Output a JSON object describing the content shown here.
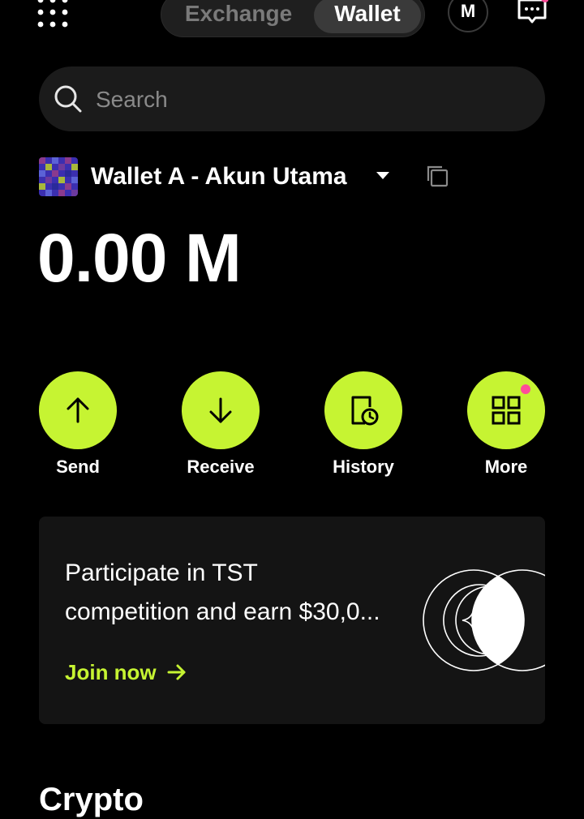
{
  "header": {
    "tabs": [
      {
        "label": "Exchange",
        "active": false
      },
      {
        "label": "Wallet",
        "active": true
      }
    ],
    "account_initial": "M",
    "icons": {
      "menu": "grid-dots-icon",
      "chat": "chat-icon"
    },
    "chat_has_notification": true
  },
  "search": {
    "placeholder": "Search",
    "value": ""
  },
  "wallet": {
    "name": "Wallet A - Akun Utama",
    "balance": "0.00 M"
  },
  "actions": [
    {
      "label": "Send",
      "icon": "arrow-up-icon"
    },
    {
      "label": "Receive",
      "icon": "arrow-down-icon"
    },
    {
      "label": "History",
      "icon": "history-icon"
    },
    {
      "label": "More",
      "icon": "apps-grid-icon",
      "has_notification": true
    }
  ],
  "promo": {
    "line1": "Participate in TST",
    "line2": "competition and earn $30,0...",
    "cta": "Join now"
  },
  "section_peek": "Crypto",
  "colors": {
    "background": "#000000",
    "accent": "#c6f432",
    "notification": "#ff4d9a",
    "surface": "#1b1b1b"
  }
}
